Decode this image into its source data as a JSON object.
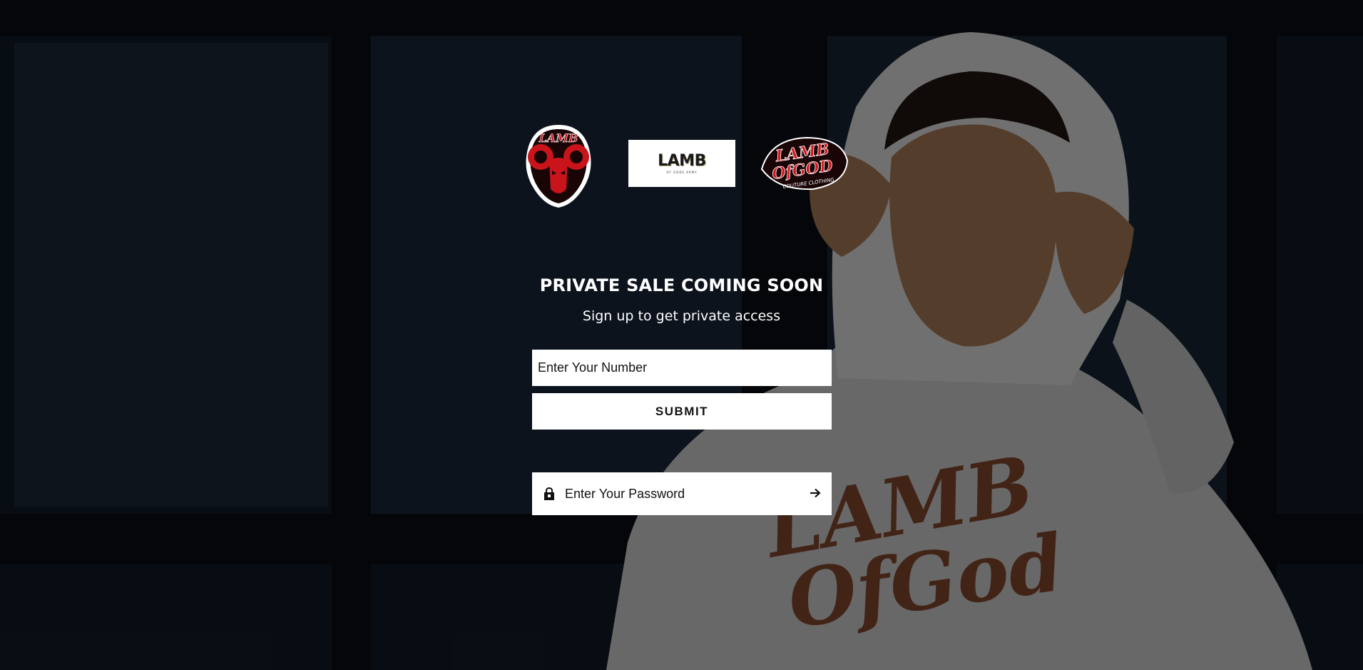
{
  "logos": {
    "left_alt": "Lamb of God ram head logo",
    "center_brand": "LAMB",
    "center_sub": "OF GODS ARMY",
    "right_alt": "Lamb of God Couture Clothing script logo"
  },
  "hero": {
    "headline": "PRIVATE SALE COMING SOON",
    "subline": "Sign up to get private access"
  },
  "signup": {
    "number_placeholder": "Enter Your Number",
    "submit_label": "SUBMIT"
  },
  "password": {
    "placeholder": "Enter Your Password",
    "lock_icon": "lock-icon",
    "arrow_icon": "arrow-right-icon"
  },
  "colors": {
    "accent_red": "#d4161c",
    "text_white": "#ffffff"
  }
}
